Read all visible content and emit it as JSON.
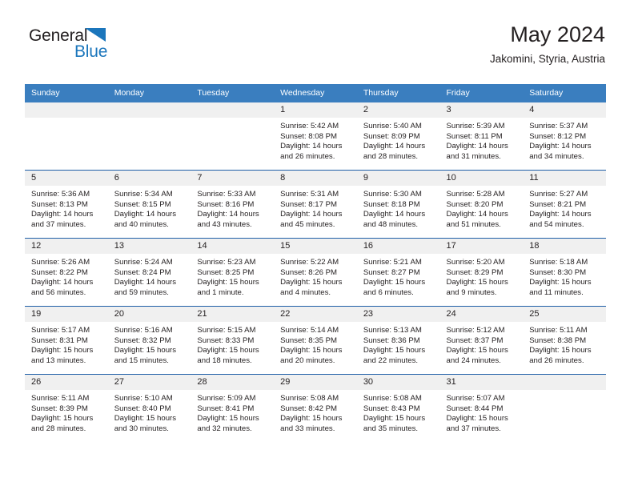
{
  "brand": {
    "name_top": "General",
    "name_bottom": "Blue",
    "triangle_color": "#1b76bc",
    "text_color": "#231f20"
  },
  "header": {
    "title": "May 2024",
    "subtitle": "Jakomini, Styria, Austria"
  },
  "theme": {
    "header_blue": "#3a7ebf",
    "separator_blue": "#1f5fa8",
    "daynum_band": "#f0f0f0",
    "text": "#231f20"
  },
  "weekday_headers": [
    "Sunday",
    "Monday",
    "Tuesday",
    "Wednesday",
    "Thursday",
    "Friday",
    "Saturday"
  ],
  "weeks": [
    [
      {
        "day": "",
        "blank": true
      },
      {
        "day": "",
        "blank": true
      },
      {
        "day": "",
        "blank": true
      },
      {
        "day": "1",
        "sunrise": "Sunrise: 5:42 AM",
        "sunset": "Sunset: 8:08 PM",
        "daylight_line1": "Daylight: 14 hours",
        "daylight_line2": "and 26 minutes."
      },
      {
        "day": "2",
        "sunrise": "Sunrise: 5:40 AM",
        "sunset": "Sunset: 8:09 PM",
        "daylight_line1": "Daylight: 14 hours",
        "daylight_line2": "and 28 minutes."
      },
      {
        "day": "3",
        "sunrise": "Sunrise: 5:39 AM",
        "sunset": "Sunset: 8:11 PM",
        "daylight_line1": "Daylight: 14 hours",
        "daylight_line2": "and 31 minutes."
      },
      {
        "day": "4",
        "sunrise": "Sunrise: 5:37 AM",
        "sunset": "Sunset: 8:12 PM",
        "daylight_line1": "Daylight: 14 hours",
        "daylight_line2": "and 34 minutes."
      }
    ],
    [
      {
        "day": "5",
        "sunrise": "Sunrise: 5:36 AM",
        "sunset": "Sunset: 8:13 PM",
        "daylight_line1": "Daylight: 14 hours",
        "daylight_line2": "and 37 minutes."
      },
      {
        "day": "6",
        "sunrise": "Sunrise: 5:34 AM",
        "sunset": "Sunset: 8:15 PM",
        "daylight_line1": "Daylight: 14 hours",
        "daylight_line2": "and 40 minutes."
      },
      {
        "day": "7",
        "sunrise": "Sunrise: 5:33 AM",
        "sunset": "Sunset: 8:16 PM",
        "daylight_line1": "Daylight: 14 hours",
        "daylight_line2": "and 43 minutes."
      },
      {
        "day": "8",
        "sunrise": "Sunrise: 5:31 AM",
        "sunset": "Sunset: 8:17 PM",
        "daylight_line1": "Daylight: 14 hours",
        "daylight_line2": "and 45 minutes."
      },
      {
        "day": "9",
        "sunrise": "Sunrise: 5:30 AM",
        "sunset": "Sunset: 8:18 PM",
        "daylight_line1": "Daylight: 14 hours",
        "daylight_line2": "and 48 minutes."
      },
      {
        "day": "10",
        "sunrise": "Sunrise: 5:28 AM",
        "sunset": "Sunset: 8:20 PM",
        "daylight_line1": "Daylight: 14 hours",
        "daylight_line2": "and 51 minutes."
      },
      {
        "day": "11",
        "sunrise": "Sunrise: 5:27 AM",
        "sunset": "Sunset: 8:21 PM",
        "daylight_line1": "Daylight: 14 hours",
        "daylight_line2": "and 54 minutes."
      }
    ],
    [
      {
        "day": "12",
        "sunrise": "Sunrise: 5:26 AM",
        "sunset": "Sunset: 8:22 PM",
        "daylight_line1": "Daylight: 14 hours",
        "daylight_line2": "and 56 minutes."
      },
      {
        "day": "13",
        "sunrise": "Sunrise: 5:24 AM",
        "sunset": "Sunset: 8:24 PM",
        "daylight_line1": "Daylight: 14 hours",
        "daylight_line2": "and 59 minutes."
      },
      {
        "day": "14",
        "sunrise": "Sunrise: 5:23 AM",
        "sunset": "Sunset: 8:25 PM",
        "daylight_line1": "Daylight: 15 hours",
        "daylight_line2": "and 1 minute."
      },
      {
        "day": "15",
        "sunrise": "Sunrise: 5:22 AM",
        "sunset": "Sunset: 8:26 PM",
        "daylight_line1": "Daylight: 15 hours",
        "daylight_line2": "and 4 minutes."
      },
      {
        "day": "16",
        "sunrise": "Sunrise: 5:21 AM",
        "sunset": "Sunset: 8:27 PM",
        "daylight_line1": "Daylight: 15 hours",
        "daylight_line2": "and 6 minutes."
      },
      {
        "day": "17",
        "sunrise": "Sunrise: 5:20 AM",
        "sunset": "Sunset: 8:29 PM",
        "daylight_line1": "Daylight: 15 hours",
        "daylight_line2": "and 9 minutes."
      },
      {
        "day": "18",
        "sunrise": "Sunrise: 5:18 AM",
        "sunset": "Sunset: 8:30 PM",
        "daylight_line1": "Daylight: 15 hours",
        "daylight_line2": "and 11 minutes."
      }
    ],
    [
      {
        "day": "19",
        "sunrise": "Sunrise: 5:17 AM",
        "sunset": "Sunset: 8:31 PM",
        "daylight_line1": "Daylight: 15 hours",
        "daylight_line2": "and 13 minutes."
      },
      {
        "day": "20",
        "sunrise": "Sunrise: 5:16 AM",
        "sunset": "Sunset: 8:32 PM",
        "daylight_line1": "Daylight: 15 hours",
        "daylight_line2": "and 15 minutes."
      },
      {
        "day": "21",
        "sunrise": "Sunrise: 5:15 AM",
        "sunset": "Sunset: 8:33 PM",
        "daylight_line1": "Daylight: 15 hours",
        "daylight_line2": "and 18 minutes."
      },
      {
        "day": "22",
        "sunrise": "Sunrise: 5:14 AM",
        "sunset": "Sunset: 8:35 PM",
        "daylight_line1": "Daylight: 15 hours",
        "daylight_line2": "and 20 minutes."
      },
      {
        "day": "23",
        "sunrise": "Sunrise: 5:13 AM",
        "sunset": "Sunset: 8:36 PM",
        "daylight_line1": "Daylight: 15 hours",
        "daylight_line2": "and 22 minutes."
      },
      {
        "day": "24",
        "sunrise": "Sunrise: 5:12 AM",
        "sunset": "Sunset: 8:37 PM",
        "daylight_line1": "Daylight: 15 hours",
        "daylight_line2": "and 24 minutes."
      },
      {
        "day": "25",
        "sunrise": "Sunrise: 5:11 AM",
        "sunset": "Sunset: 8:38 PM",
        "daylight_line1": "Daylight: 15 hours",
        "daylight_line2": "and 26 minutes."
      }
    ],
    [
      {
        "day": "26",
        "sunrise": "Sunrise: 5:11 AM",
        "sunset": "Sunset: 8:39 PM",
        "daylight_line1": "Daylight: 15 hours",
        "daylight_line2": "and 28 minutes."
      },
      {
        "day": "27",
        "sunrise": "Sunrise: 5:10 AM",
        "sunset": "Sunset: 8:40 PM",
        "daylight_line1": "Daylight: 15 hours",
        "daylight_line2": "and 30 minutes."
      },
      {
        "day": "28",
        "sunrise": "Sunrise: 5:09 AM",
        "sunset": "Sunset: 8:41 PM",
        "daylight_line1": "Daylight: 15 hours",
        "daylight_line2": "and 32 minutes."
      },
      {
        "day": "29",
        "sunrise": "Sunrise: 5:08 AM",
        "sunset": "Sunset: 8:42 PM",
        "daylight_line1": "Daylight: 15 hours",
        "daylight_line2": "and 33 minutes."
      },
      {
        "day": "30",
        "sunrise": "Sunrise: 5:08 AM",
        "sunset": "Sunset: 8:43 PM",
        "daylight_line1": "Daylight: 15 hours",
        "daylight_line2": "and 35 minutes."
      },
      {
        "day": "31",
        "sunrise": "Sunrise: 5:07 AM",
        "sunset": "Sunset: 8:44 PM",
        "daylight_line1": "Daylight: 15 hours",
        "daylight_line2": "and 37 minutes."
      },
      {
        "day": "",
        "blank": true
      }
    ]
  ]
}
